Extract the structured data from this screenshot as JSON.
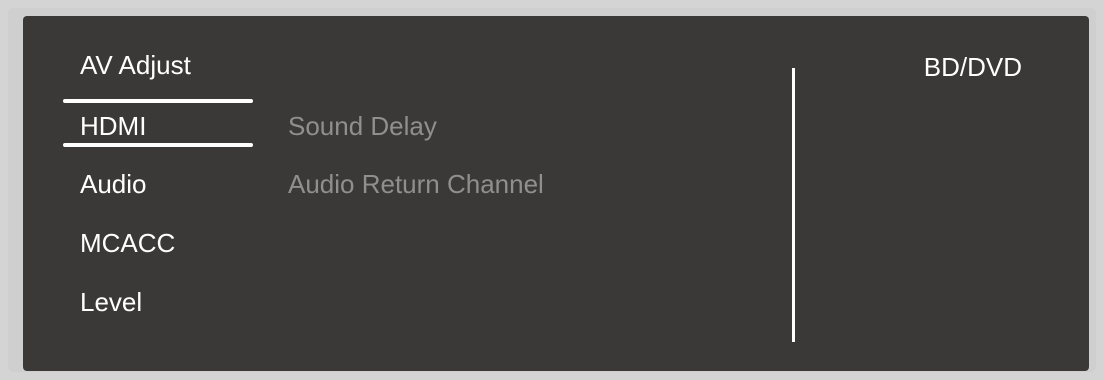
{
  "header": {
    "title": "AV Adjust",
    "source": "BD/DVD"
  },
  "menu": {
    "items": [
      {
        "label": "HDMI",
        "selected": true
      },
      {
        "label": "Audio",
        "selected": false
      },
      {
        "label": "MCACC",
        "selected": false
      },
      {
        "label": "Level",
        "selected": false
      }
    ]
  },
  "submenu": {
    "items": [
      {
        "label": "Sound Delay",
        "enabled": false
      },
      {
        "label": "Audio Return Channel",
        "enabled": false
      }
    ]
  },
  "colors": {
    "panel_background": "#3a3938",
    "text_active": "#ffffff",
    "text_disabled": "#8f8f8f"
  }
}
